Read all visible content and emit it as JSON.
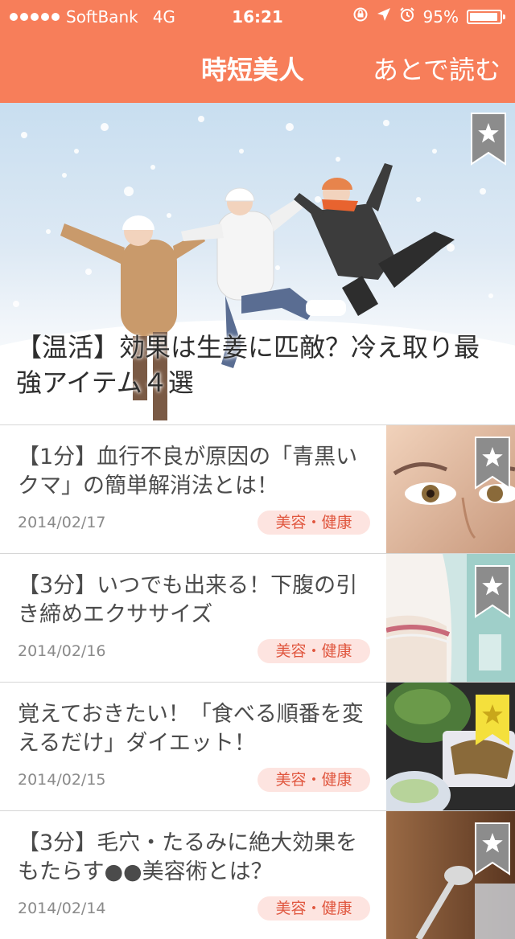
{
  "status": {
    "carrier": "SoftBank",
    "network": "4G",
    "time": "16:21",
    "battery_percent": "95%",
    "battery_level": 0.95,
    "icons": [
      "rotation-lock-icon",
      "location-arrow-icon",
      "alarm-icon"
    ]
  },
  "nav": {
    "title": "時短美人",
    "read_later": "あとで読む"
  },
  "colors": {
    "header": "#f77e5a",
    "tag_bg": "#fde4e0",
    "tag_text": "#e0563e",
    "ribbon_gray": "#8c8c8c",
    "ribbon_yellow": "#f4e03c"
  },
  "featured": {
    "title": "【温活】効果は生姜に匹敵？冷え取り最強アイテム４選",
    "bookmarked": false,
    "icon": "star-icon"
  },
  "articles": [
    {
      "title": "【1分】血行不良が原因の「青黒いクマ」の簡単解消法とは！",
      "date": "2014/02/17",
      "tag": "美容・健康",
      "bookmarked": false,
      "thumb": "eye"
    },
    {
      "title": "【3分】いつでも出来る！下腹の引き締めエクササイズ",
      "date": "2014/02/16",
      "tag": "美容・健康",
      "bookmarked": false,
      "thumb": "waist"
    },
    {
      "title": "覚えておきたい！「食べる順番を変えるだけ」ダイエット！",
      "date": "2014/02/15",
      "tag": "美容・健康",
      "bookmarked": true,
      "thumb": "food"
    },
    {
      "title": "【3分】毛穴・たるみに絶大効果をもたらす●●美容術とは？",
      "date": "2014/02/14",
      "tag": "美容・健康",
      "bookmarked": false,
      "thumb": "spoon"
    }
  ]
}
